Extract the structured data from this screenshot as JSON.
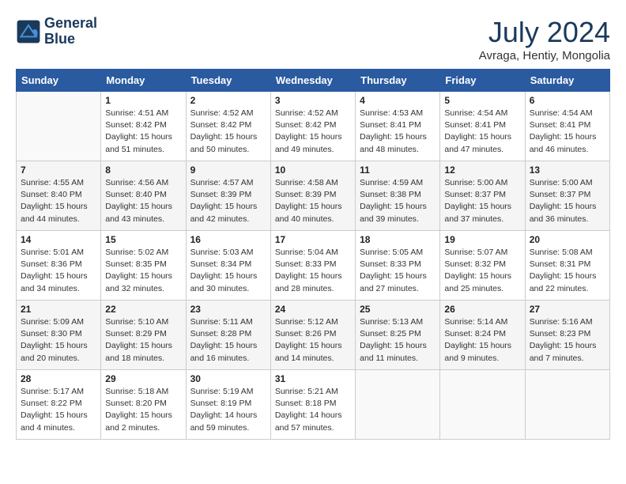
{
  "logo": {
    "line1": "General",
    "line2": "Blue"
  },
  "title": "July 2024",
  "subtitle": "Avraga, Hentiy, Mongolia",
  "header_days": [
    "Sunday",
    "Monday",
    "Tuesday",
    "Wednesday",
    "Thursday",
    "Friday",
    "Saturday"
  ],
  "weeks": [
    [
      {
        "day": "",
        "info": ""
      },
      {
        "day": "1",
        "info": "Sunrise: 4:51 AM\nSunset: 8:42 PM\nDaylight: 15 hours\nand 51 minutes."
      },
      {
        "day": "2",
        "info": "Sunrise: 4:52 AM\nSunset: 8:42 PM\nDaylight: 15 hours\nand 50 minutes."
      },
      {
        "day": "3",
        "info": "Sunrise: 4:52 AM\nSunset: 8:42 PM\nDaylight: 15 hours\nand 49 minutes."
      },
      {
        "day": "4",
        "info": "Sunrise: 4:53 AM\nSunset: 8:41 PM\nDaylight: 15 hours\nand 48 minutes."
      },
      {
        "day": "5",
        "info": "Sunrise: 4:54 AM\nSunset: 8:41 PM\nDaylight: 15 hours\nand 47 minutes."
      },
      {
        "day": "6",
        "info": "Sunrise: 4:54 AM\nSunset: 8:41 PM\nDaylight: 15 hours\nand 46 minutes."
      }
    ],
    [
      {
        "day": "7",
        "info": "Sunrise: 4:55 AM\nSunset: 8:40 PM\nDaylight: 15 hours\nand 44 minutes."
      },
      {
        "day": "8",
        "info": "Sunrise: 4:56 AM\nSunset: 8:40 PM\nDaylight: 15 hours\nand 43 minutes."
      },
      {
        "day": "9",
        "info": "Sunrise: 4:57 AM\nSunset: 8:39 PM\nDaylight: 15 hours\nand 42 minutes."
      },
      {
        "day": "10",
        "info": "Sunrise: 4:58 AM\nSunset: 8:39 PM\nDaylight: 15 hours\nand 40 minutes."
      },
      {
        "day": "11",
        "info": "Sunrise: 4:59 AM\nSunset: 8:38 PM\nDaylight: 15 hours\nand 39 minutes."
      },
      {
        "day": "12",
        "info": "Sunrise: 5:00 AM\nSunset: 8:37 PM\nDaylight: 15 hours\nand 37 minutes."
      },
      {
        "day": "13",
        "info": "Sunrise: 5:00 AM\nSunset: 8:37 PM\nDaylight: 15 hours\nand 36 minutes."
      }
    ],
    [
      {
        "day": "14",
        "info": "Sunrise: 5:01 AM\nSunset: 8:36 PM\nDaylight: 15 hours\nand 34 minutes."
      },
      {
        "day": "15",
        "info": "Sunrise: 5:02 AM\nSunset: 8:35 PM\nDaylight: 15 hours\nand 32 minutes."
      },
      {
        "day": "16",
        "info": "Sunrise: 5:03 AM\nSunset: 8:34 PM\nDaylight: 15 hours\nand 30 minutes."
      },
      {
        "day": "17",
        "info": "Sunrise: 5:04 AM\nSunset: 8:33 PM\nDaylight: 15 hours\nand 28 minutes."
      },
      {
        "day": "18",
        "info": "Sunrise: 5:05 AM\nSunset: 8:33 PM\nDaylight: 15 hours\nand 27 minutes."
      },
      {
        "day": "19",
        "info": "Sunrise: 5:07 AM\nSunset: 8:32 PM\nDaylight: 15 hours\nand 25 minutes."
      },
      {
        "day": "20",
        "info": "Sunrise: 5:08 AM\nSunset: 8:31 PM\nDaylight: 15 hours\nand 22 minutes."
      }
    ],
    [
      {
        "day": "21",
        "info": "Sunrise: 5:09 AM\nSunset: 8:30 PM\nDaylight: 15 hours\nand 20 minutes."
      },
      {
        "day": "22",
        "info": "Sunrise: 5:10 AM\nSunset: 8:29 PM\nDaylight: 15 hours\nand 18 minutes."
      },
      {
        "day": "23",
        "info": "Sunrise: 5:11 AM\nSunset: 8:28 PM\nDaylight: 15 hours\nand 16 minutes."
      },
      {
        "day": "24",
        "info": "Sunrise: 5:12 AM\nSunset: 8:26 PM\nDaylight: 15 hours\nand 14 minutes."
      },
      {
        "day": "25",
        "info": "Sunrise: 5:13 AM\nSunset: 8:25 PM\nDaylight: 15 hours\nand 11 minutes."
      },
      {
        "day": "26",
        "info": "Sunrise: 5:14 AM\nSunset: 8:24 PM\nDaylight: 15 hours\nand 9 minutes."
      },
      {
        "day": "27",
        "info": "Sunrise: 5:16 AM\nSunset: 8:23 PM\nDaylight: 15 hours\nand 7 minutes."
      }
    ],
    [
      {
        "day": "28",
        "info": "Sunrise: 5:17 AM\nSunset: 8:22 PM\nDaylight: 15 hours\nand 4 minutes."
      },
      {
        "day": "29",
        "info": "Sunrise: 5:18 AM\nSunset: 8:20 PM\nDaylight: 15 hours\nand 2 minutes."
      },
      {
        "day": "30",
        "info": "Sunrise: 5:19 AM\nSunset: 8:19 PM\nDaylight: 14 hours\nand 59 minutes."
      },
      {
        "day": "31",
        "info": "Sunrise: 5:21 AM\nSunset: 8:18 PM\nDaylight: 14 hours\nand 57 minutes."
      },
      {
        "day": "",
        "info": ""
      },
      {
        "day": "",
        "info": ""
      },
      {
        "day": "",
        "info": ""
      }
    ]
  ]
}
